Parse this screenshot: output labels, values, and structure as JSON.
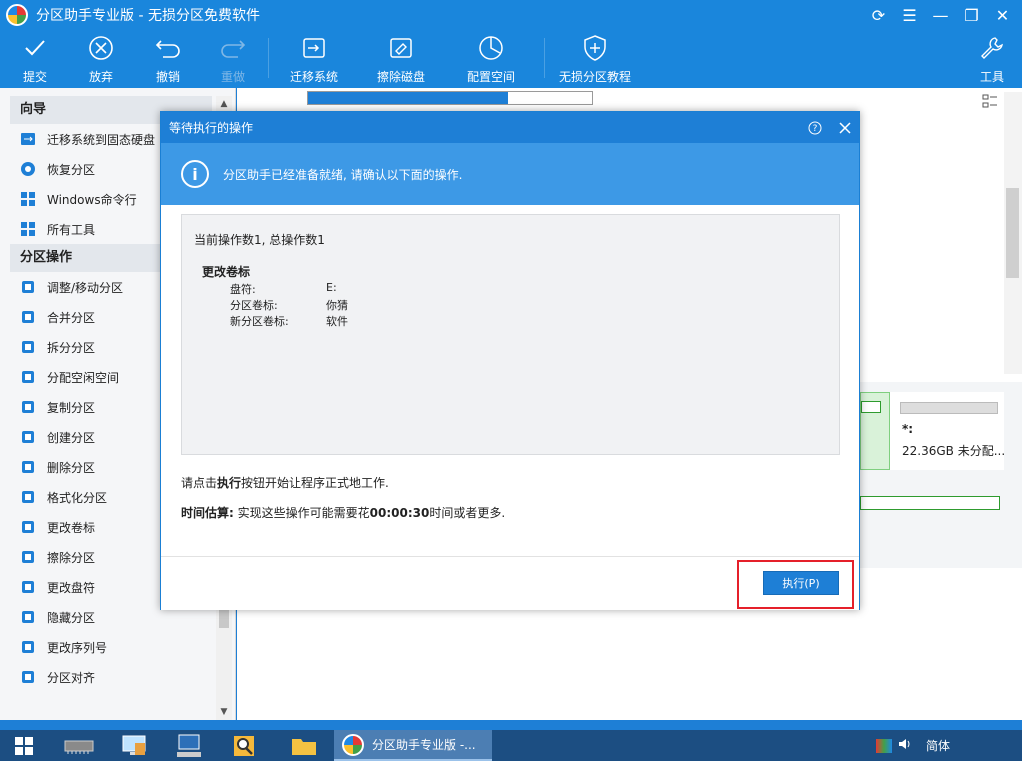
{
  "window": {
    "title": "分区助手专业版 - 无损分区免费软件"
  },
  "toolbar": {
    "commit": "提交",
    "discard": "放弃",
    "undo": "撤销",
    "redo": "重做",
    "migrate_os": "迁移系统",
    "wipe_disk": "擦除磁盘",
    "allocate_space": "配置空间",
    "tutorial": "无损分区教程",
    "tools": "工具"
  },
  "sidebar": {
    "wizard_header": "向导",
    "wizard_items": [
      {
        "label": "迁移系统到固态硬盘",
        "icon": "migrate-ssd-icon"
      },
      {
        "label": "恢复分区",
        "icon": "recover-partition-icon"
      },
      {
        "label": "Windows命令行",
        "icon": "windows-icon"
      },
      {
        "label": "所有工具",
        "icon": "all-tools-icon"
      }
    ],
    "ops_header": "分区操作",
    "ops_items": [
      {
        "label": "调整/移动分区",
        "icon": "resize-icon"
      },
      {
        "label": "合并分区",
        "icon": "merge-icon"
      },
      {
        "label": "拆分分区",
        "icon": "split-icon"
      },
      {
        "label": "分配空闲空间",
        "icon": "allocate-icon"
      },
      {
        "label": "复制分区",
        "icon": "copy-icon"
      },
      {
        "label": "创建分区",
        "icon": "create-icon"
      },
      {
        "label": "删除分区",
        "icon": "delete-icon"
      },
      {
        "label": "格式化分区",
        "icon": "format-icon"
      },
      {
        "label": "更改卷标",
        "icon": "label-icon"
      },
      {
        "label": "擦除分区",
        "icon": "wipe-icon"
      },
      {
        "label": "更改盘符",
        "icon": "drive-letter-icon"
      },
      {
        "label": "隐藏分区",
        "icon": "hide-icon"
      },
      {
        "label": "更改序列号",
        "icon": "serial-icon"
      },
      {
        "label": "分区对齐",
        "icon": "align-icon"
      }
    ]
  },
  "disk": {
    "unallocated_label": "*:",
    "unallocated_size": "22.36GB 未分配..."
  },
  "dialog": {
    "title": "等待执行的操作",
    "banner": "分区助手已经准备就绪, 请确认以下面的操作.",
    "ops_count": "当前操作数1,  总操作数1",
    "op_title": "更改卷标",
    "op_rows": [
      {
        "key": "盘符:",
        "value": "E:"
      },
      {
        "key": "分区卷标:",
        "value": "你猜"
      },
      {
        "key": "新分区卷标:",
        "value": "软件"
      }
    ],
    "instr_prefix": "请点击",
    "instr_bold": "执行",
    "instr_suffix": "按钮开始让程序正式地工作.",
    "estimate_label": "时间估算:",
    "estimate_mid": " 实现这些操作可能需要花",
    "estimate_time": "00:00:30",
    "estimate_suffix": "时间或者更多.",
    "execute_button": "执行(P)"
  },
  "taskbar": {
    "active_app": "分区助手专业版 -...",
    "ime": "简体"
  }
}
